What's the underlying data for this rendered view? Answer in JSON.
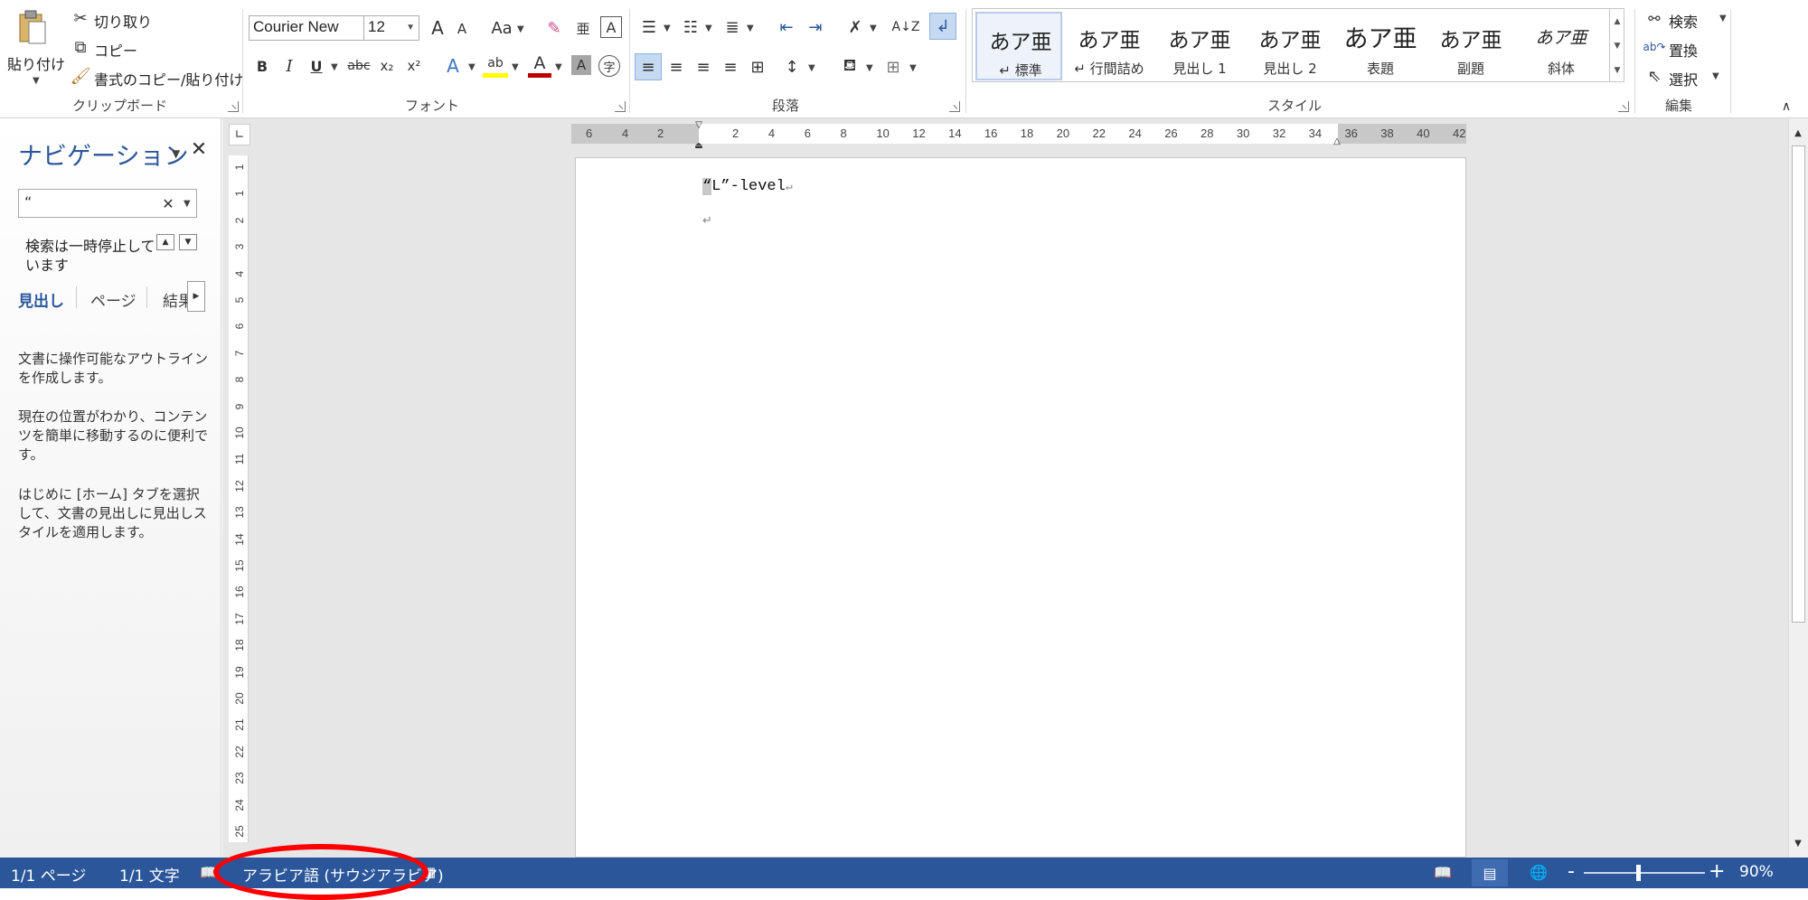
{
  "clipboard": {
    "paste": "貼り付け",
    "cut": "切り取り",
    "copy": "コピー",
    "format_painter": "書式のコピー/貼り付け",
    "label": "クリップボード"
  },
  "font": {
    "name": "Courier New",
    "size": "12",
    "grow": "A",
    "shrink": "A",
    "case": "Aa",
    "bold": "B",
    "italic": "I",
    "underline": "U",
    "strike": "abc",
    "sub": "x₂",
    "sup": "x²",
    "label": "フォント"
  },
  "paragraph": {
    "label": "段落"
  },
  "styles": {
    "label": "スタイル",
    "items": [
      {
        "sample": "あア亜",
        "name": "↵ 標準"
      },
      {
        "sample": "あア亜",
        "name": "↵ 行間詰め"
      },
      {
        "sample": "あア亜",
        "name": "見出し 1"
      },
      {
        "sample": "あア亜",
        "name": "見出し 2"
      },
      {
        "sample": "あア亜",
        "name": "表題"
      },
      {
        "sample": "あア亜",
        "name": "副題"
      },
      {
        "sample": "あア亜",
        "name": "斜体"
      }
    ]
  },
  "editing": {
    "find": "検索",
    "replace": "置換",
    "select": "選択",
    "label": "編集"
  },
  "nav": {
    "title": "ナビゲーション",
    "search_value": "“",
    "paused_line1": "検索は一時停止して",
    "paused_line2": "います",
    "tabs": [
      "見出し",
      "ページ",
      "結果"
    ],
    "text1": "文書に操作可能なアウトラインを作成します。",
    "text2": "現在の位置がわかり、コンテンツを簡単に移動するのに便利です。",
    "text3": "はじめに [ホーム] タブを選択して、文書の見出しに見出しスタイルを適用します。"
  },
  "ruler": {
    "h_left": [
      "6",
      "4",
      "2"
    ],
    "h_right": [
      "2",
      "4",
      "6",
      "8",
      "10",
      "12",
      "14",
      "16",
      "18",
      "20",
      "22",
      "24",
      "26",
      "28",
      "30",
      "32",
      "34",
      "36",
      "38",
      "40",
      "42"
    ],
    "v": [
      "1",
      "1",
      "2",
      "3",
      "4",
      "5",
      "6",
      "7",
      "8",
      "9",
      "10",
      "11",
      "12",
      "13",
      "14",
      "15",
      "16",
      "17",
      "18",
      "19",
      "20",
      "21",
      "22",
      "23",
      "24",
      "25"
    ]
  },
  "document": {
    "line1_quote": "“",
    "line1_rest": "L”-level",
    "mark": "↵"
  },
  "status": {
    "page": "1/1 ページ",
    "words": "1/1 文字",
    "language": "アラビア語 (サウジアラビア)",
    "zoom": "90%",
    "zoom_minus": "-",
    "zoom_plus": "+"
  },
  "colors": {
    "accent": "#2b579a",
    "highlight_ring": "#ff0000",
    "highlight_color": "#ffff00",
    "font_color": "#c00000"
  }
}
